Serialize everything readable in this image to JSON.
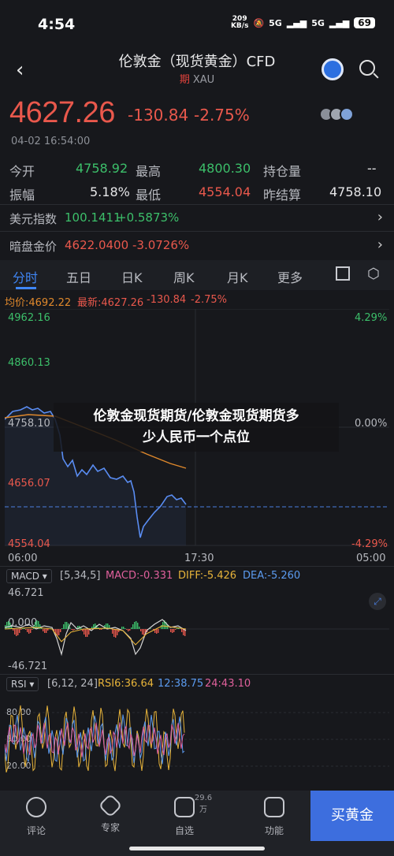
{
  "status": {
    "time": "4:54",
    "net_speed_top": "209",
    "net_speed_unit": "KB/s",
    "signal1": "5G",
    "signal2": "5G",
    "battery": "69"
  },
  "header": {
    "title": "伦敦金（现货黄金）CFD",
    "badge": "期",
    "code": "XAU"
  },
  "quote": {
    "price": "4627.26",
    "change": "-130.84",
    "change_pct": "-2.75%",
    "datetime": "04-02 16:54:00",
    "open_label": "今开",
    "open": "4758.92",
    "high_label": "最高",
    "high": "4800.30",
    "oi_label": "持仓量",
    "oi": "--",
    "amp_label": "振幅",
    "amp": "5.18%",
    "low_label": "最低",
    "low": "4554.04",
    "prev_label": "昨结算",
    "prev": "4758.10"
  },
  "related": [
    {
      "name": "美元指数",
      "value": "100.1411",
      "change": "+0.5873%"
    },
    {
      "name": "暗盘金价",
      "value": "4622.0400",
      "change": "-3.0726%"
    }
  ],
  "tabs": [
    "分时",
    "五日",
    "日K",
    "周K",
    "月K",
    "更多"
  ],
  "legend": {
    "avg": "均价:4692.22",
    "latest": "最新:4627.26",
    "chg": "-130.84",
    "pct": "-2.75%"
  },
  "axis": {
    "y_left": [
      "4962.16",
      "4860.13",
      "4758.10",
      "4656.07",
      "4554.04"
    ],
    "y_right": [
      "4.29%",
      "0.00%",
      "-4.29%"
    ],
    "x": [
      "06:00",
      "17:30",
      "05:00"
    ]
  },
  "macd": {
    "label": "MACD",
    "params": "[5,34,5]",
    "macd": "MACD:-0.331",
    "diff": "DIFF:-5.426",
    "dea": "DEA:-5.260",
    "y_top": "46.721",
    "y_mid": "0.000",
    "y_bot": "-46.721"
  },
  "rsi": {
    "label": "RSI",
    "params": "[6,12, 24]",
    "rsi6": "RSI6:36.64",
    "rsi12": "12:38.75",
    "rsi24": "24:43.10",
    "y80": "80.00",
    "y50": "50.00",
    "y20": "20.00"
  },
  "banner": {
    "line1": "伦敦金现货期货/伦敦金现货期货多",
    "line2": "少人民币一个点位"
  },
  "bottom": {
    "comment": "评论",
    "expert": "专家",
    "watch": "自选",
    "watch_count": "29.6万",
    "func": "功能",
    "buy": "买黄金"
  },
  "colors": {
    "up": "#e9584c",
    "down": "#3cbf6a",
    "accent": "#3f86f5",
    "avg_line": "#e0892c"
  }
}
